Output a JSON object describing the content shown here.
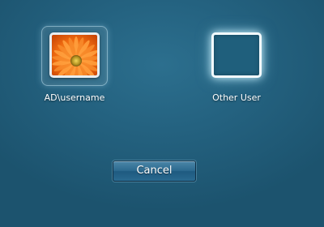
{
  "accounts": [
    {
      "label": "AD\\username",
      "picture": "orange-flower-user-picture"
    },
    {
      "label": "Other User",
      "picture": "empty-user-picture"
    }
  ],
  "cancel_label": "Cancel",
  "colors": {
    "background": "#246280",
    "frame_border": "#e8eef1",
    "button_top": "#4b86a8",
    "button_bottom": "#1e5a80",
    "flower_petals": "#f07a10",
    "flower_center": "#c4a020"
  }
}
